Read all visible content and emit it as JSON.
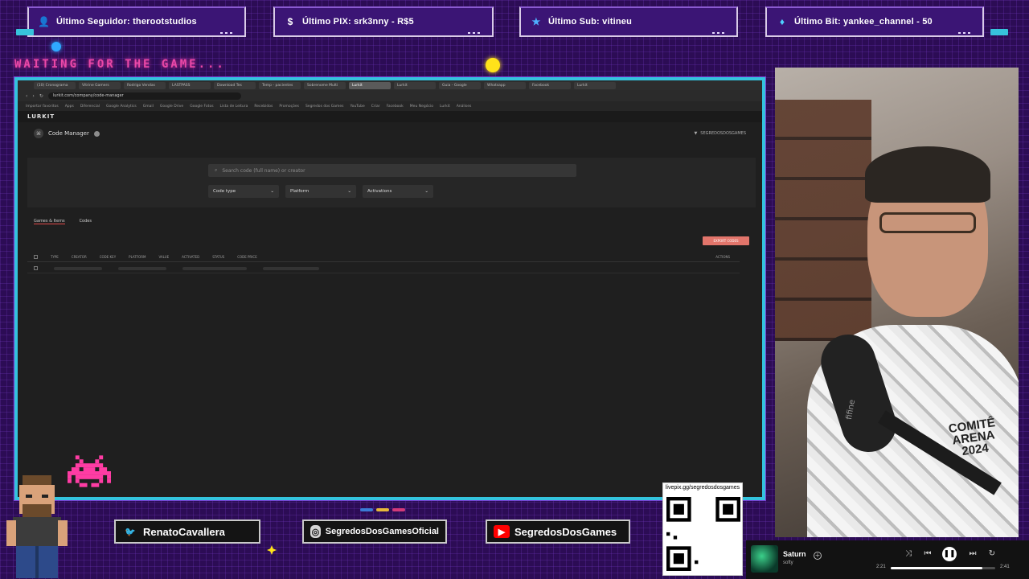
{
  "alerts": {
    "follower": "Último Seguidor: therootstudios",
    "pix": "Último PIX: srk3nny - R$5",
    "sub": "Último Sub: vitineu",
    "bit": "Último Bit: yankee_channel - 50"
  },
  "waiting_text": "WAITING FOR THE GAME...",
  "browser": {
    "tabs": [
      "(10) Cronograma",
      "Vitrine Gamers",
      "Rodrigo Vendas",
      "LASTPASS",
      "Download Tes",
      "Temp - pacientes",
      "Sobrenome Multi",
      "Lurkit",
      "Lurkit",
      "Guia - Google",
      "Whatsapp",
      "Facebook",
      "Lurkit"
    ],
    "active_tab_index": 7,
    "url": "lurkit.com/company/code-manager",
    "bookmarks": [
      "Importar favoritos",
      "Apps",
      "Diferencial",
      "Google Analytics",
      "Gmail",
      "Google Drive",
      "Google Fotos",
      "Lista de Leitura",
      "Recebidos",
      "Promoções",
      "Segredos dos Games",
      "YouTube",
      "Criar",
      "Facebook",
      "Meu Negócio",
      "Lurkit",
      "Análises"
    ],
    "site_logo": "LURKIT",
    "page_title": "Code Manager",
    "header_right": "SEGREDOSDOSGAMES",
    "search_placeholder": "Search code (full name) or creator",
    "dropdowns": [
      "Code type",
      "Platform",
      "Activations"
    ],
    "content_tabs": [
      "Games & Items",
      "Codes"
    ],
    "export_button": "EXPORT CODES",
    "table_headers": [
      "TYPE",
      "CREATOR",
      "CODE KEY",
      "PLATFORM",
      "VALUE",
      "ACTIVATED",
      "STATUS",
      "CODE PRICE",
      "ACTIONS"
    ]
  },
  "socials": {
    "twitter": "RenatoCavallera",
    "instagram": "SegredosDosGamesOficial",
    "youtube": "SegredosDosGames"
  },
  "qr": {
    "url": "livepix.gg/segredosdosgames"
  },
  "webcam": {
    "shirt_text": "COMITÊ ARENA 2024",
    "mic_brand": "fifine"
  },
  "player": {
    "track": "Saturn",
    "artist": "softy",
    "elapsed": "2:21",
    "duration": "2:41",
    "progress": 0.876
  },
  "colors": {
    "frame_border": "#33c3dd",
    "background": "#2c0c55",
    "waiting": "#ff4fb0",
    "export_button": "#e2756b"
  }
}
